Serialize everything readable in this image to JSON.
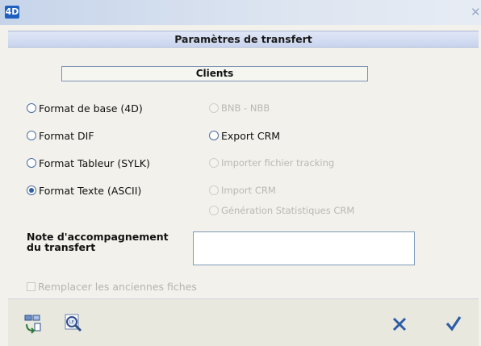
{
  "window": {
    "app_icon": "4D",
    "close_glyph": "✕"
  },
  "header": {
    "title": "Paramètres de transfert"
  },
  "section": {
    "title": "Clients"
  },
  "left_options": [
    {
      "label": "Format de base (4D)",
      "checked": false,
      "disabled": false
    },
    {
      "label": "Format DIF",
      "checked": false,
      "disabled": false
    },
    {
      "label": "Format Tableur (SYLK)",
      "checked": false,
      "disabled": false
    },
    {
      "label": "Format Texte (ASCII)",
      "checked": true,
      "disabled": false
    }
  ],
  "right_options": [
    {
      "label": "BNB - NBB",
      "checked": false,
      "disabled": true
    },
    {
      "label": "Export CRM",
      "checked": false,
      "disabled": false
    },
    {
      "label": "Importer fichier tracking",
      "checked": false,
      "disabled": true
    },
    {
      "label": "Import CRM",
      "checked": false,
      "disabled": true
    },
    {
      "label": "Génération Statistiques CRM",
      "checked": false,
      "disabled": true
    }
  ],
  "note": {
    "label_line1": "Note d'accompagnement",
    "label_line2": "du transfert",
    "value": ""
  },
  "replace": {
    "label": "Remplacer les anciennes fiches",
    "checked": false,
    "disabled": true
  },
  "toolbar": {
    "icons": [
      "refresh-records-icon",
      "search-magnifier-icon",
      "cancel-icon",
      "validate-check-icon"
    ],
    "colors": {
      "cancel": "#2d5da8",
      "validate": "#2d5da8"
    }
  }
}
